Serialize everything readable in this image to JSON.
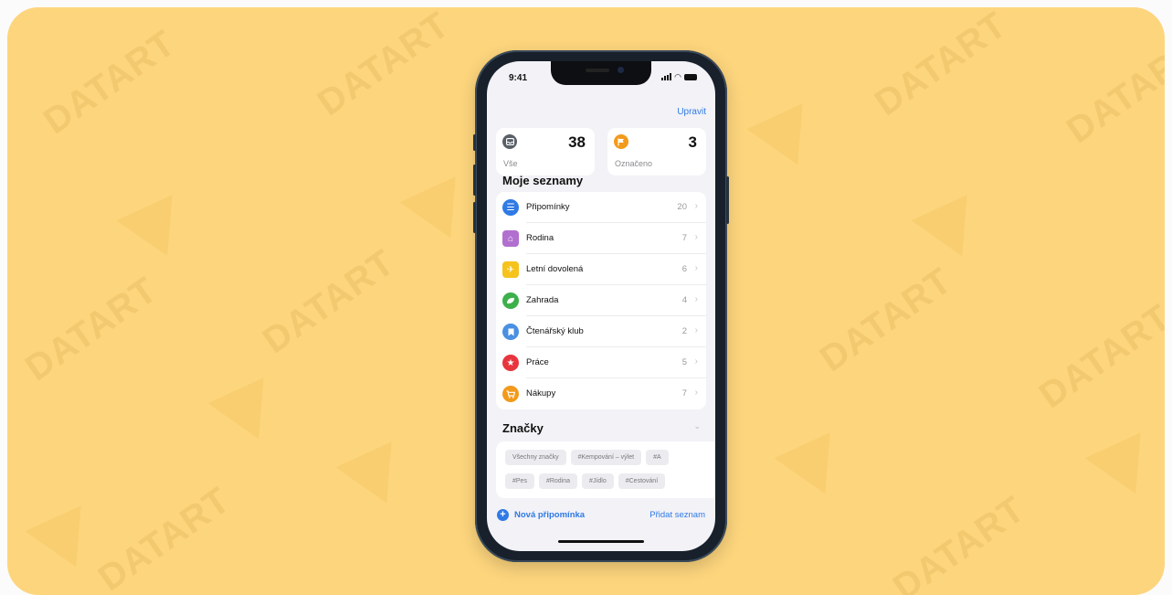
{
  "status_bar": {
    "time": "9:41"
  },
  "header": {
    "edit_label": "Upravit"
  },
  "smart_lists": [
    {
      "label": "Vše",
      "count": "38",
      "icon": "tray-icon",
      "color": "#5a6068"
    },
    {
      "label": "Označeno",
      "count": "3",
      "icon": "flag-icon",
      "color": "#f29a1b"
    }
  ],
  "my_lists": {
    "title": "Moje seznamy",
    "items": [
      {
        "label": "Připomínky",
        "count": "20",
        "icon": "list-icon",
        "color": "#2f7ae5"
      },
      {
        "label": "Rodina",
        "count": "7",
        "icon": "house-icon",
        "color": "#b16fcf"
      },
      {
        "label": "Letní dovolená",
        "count": "6",
        "icon": "airplane-icon",
        "color": "#f6c21c"
      },
      {
        "label": "Zahrada",
        "count": "4",
        "icon": "leaf-icon",
        "color": "#3cb04a"
      },
      {
        "label": "Čtenářský klub",
        "count": "2",
        "icon": "bookmark-icon",
        "color": "#4a90e2"
      },
      {
        "label": "Práce",
        "count": "5",
        "icon": "star-icon",
        "color": "#e8353d"
      },
      {
        "label": "Nákupy",
        "count": "7",
        "icon": "cart-icon",
        "color": "#f29a1b"
      }
    ]
  },
  "tags": {
    "title": "Značky",
    "row1": [
      "Všechny značky",
      "#Kempování – výlet",
      "#A"
    ],
    "row2": [
      "#Pes",
      "#Rodina",
      "#Jídlo",
      "#Cestování"
    ]
  },
  "footer": {
    "new_reminder_label": "Nová připomínka",
    "add_list_label": "Přidat seznam"
  }
}
